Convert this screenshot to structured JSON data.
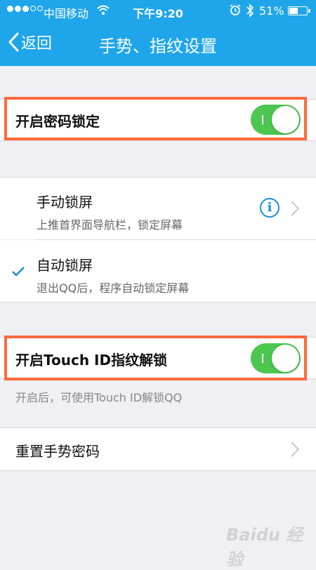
{
  "status_bar": {
    "carrier": "中国移动",
    "time": "下午9:20",
    "battery": "51%"
  },
  "nav": {
    "back_label": "返回",
    "title": "手势、指纹设置"
  },
  "passcode_lock": {
    "label": "开启密码锁定",
    "enabled": true
  },
  "lock_modes": [
    {
      "title": "手动锁屏",
      "subtitle": "上推首界面导航栏，锁定屏幕",
      "selected": false
    },
    {
      "title": "自动锁屏",
      "subtitle": "退出QQ后，程序自动锁定屏幕",
      "selected": true
    }
  ],
  "touch_id": {
    "label": "开启Touch ID指纹解锁",
    "enabled": true,
    "note": "开启后，可使用Touch ID解锁QQ"
  },
  "reset_gesture": {
    "label": "重置手势密码"
  },
  "watermark": "Baidu 经验",
  "colors": {
    "header": "#1fa6ea",
    "toggle_on": "#4cc74f",
    "highlight": "#ff6a3d",
    "checkmark": "#1a8fd8"
  }
}
